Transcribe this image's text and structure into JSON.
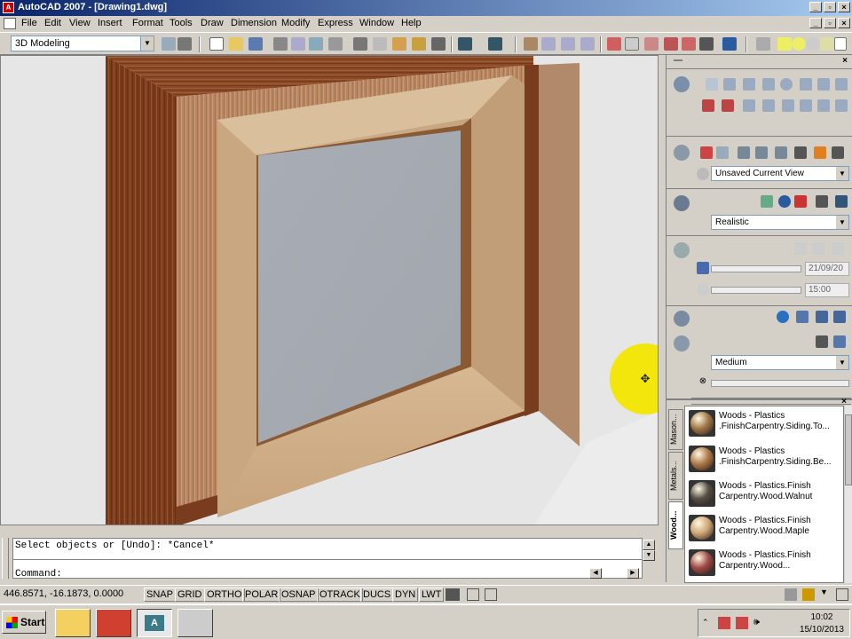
{
  "window": {
    "title": "AutoCAD 2007 - [Drawing1.dwg]"
  },
  "menu": [
    "File",
    "Edit",
    "View",
    "Insert",
    "Format",
    "Tools",
    "Draw",
    "Dimension",
    "Modify",
    "Express",
    "Window",
    "Help"
  ],
  "toolbar": {
    "workspace": "3D Modeling"
  },
  "dashboard": {
    "view": "Unsaved Current View",
    "visual_style": "Realistic",
    "sun_date": "21/09/20",
    "sun_time": "15:00",
    "render_quality": "Medium"
  },
  "palettes": {
    "tabs": [
      "Mason...",
      "Metals...",
      "Wood..."
    ],
    "materials": [
      {
        "label": "Woods - Plastics\n.FinishCarpentry.Siding.To...",
        "color": "#a07848"
      },
      {
        "label": "Woods - Plastics\n.FinishCarpentry.Siding.Be...",
        "color": "#b07a4a"
      },
      {
        "label": "Woods - Plastics.Finish\nCarpentry.Wood.Walnut",
        "color": "#555048"
      },
      {
        "label": "Woods - Plastics.Finish\nCarpentry.Wood.Maple",
        "color": "#d0a878"
      },
      {
        "label": "Woods - Plastics.Finish\nCarpentry.Wood...",
        "color": "#a04a48"
      }
    ]
  },
  "command": {
    "history": "Select objects or [Undo]: *Cancel*",
    "prompt": "Command:"
  },
  "status": {
    "coords": "446.8571, -16.1873, 0.0000",
    "buttons": [
      "SNAP",
      "GRID",
      "ORTHO",
      "POLAR",
      "OSNAP",
      "OTRACK",
      "DUCS",
      "DYN",
      "LWT"
    ]
  },
  "taskbar": {
    "start": "Start",
    "time": "10:02",
    "date": "15/10/2013"
  },
  "colors": {
    "wood_dark": "#7a3c1e",
    "wood_light": "#c8a880",
    "glass": "#a6abb3",
    "cursor_highlight": "#f2e600"
  }
}
